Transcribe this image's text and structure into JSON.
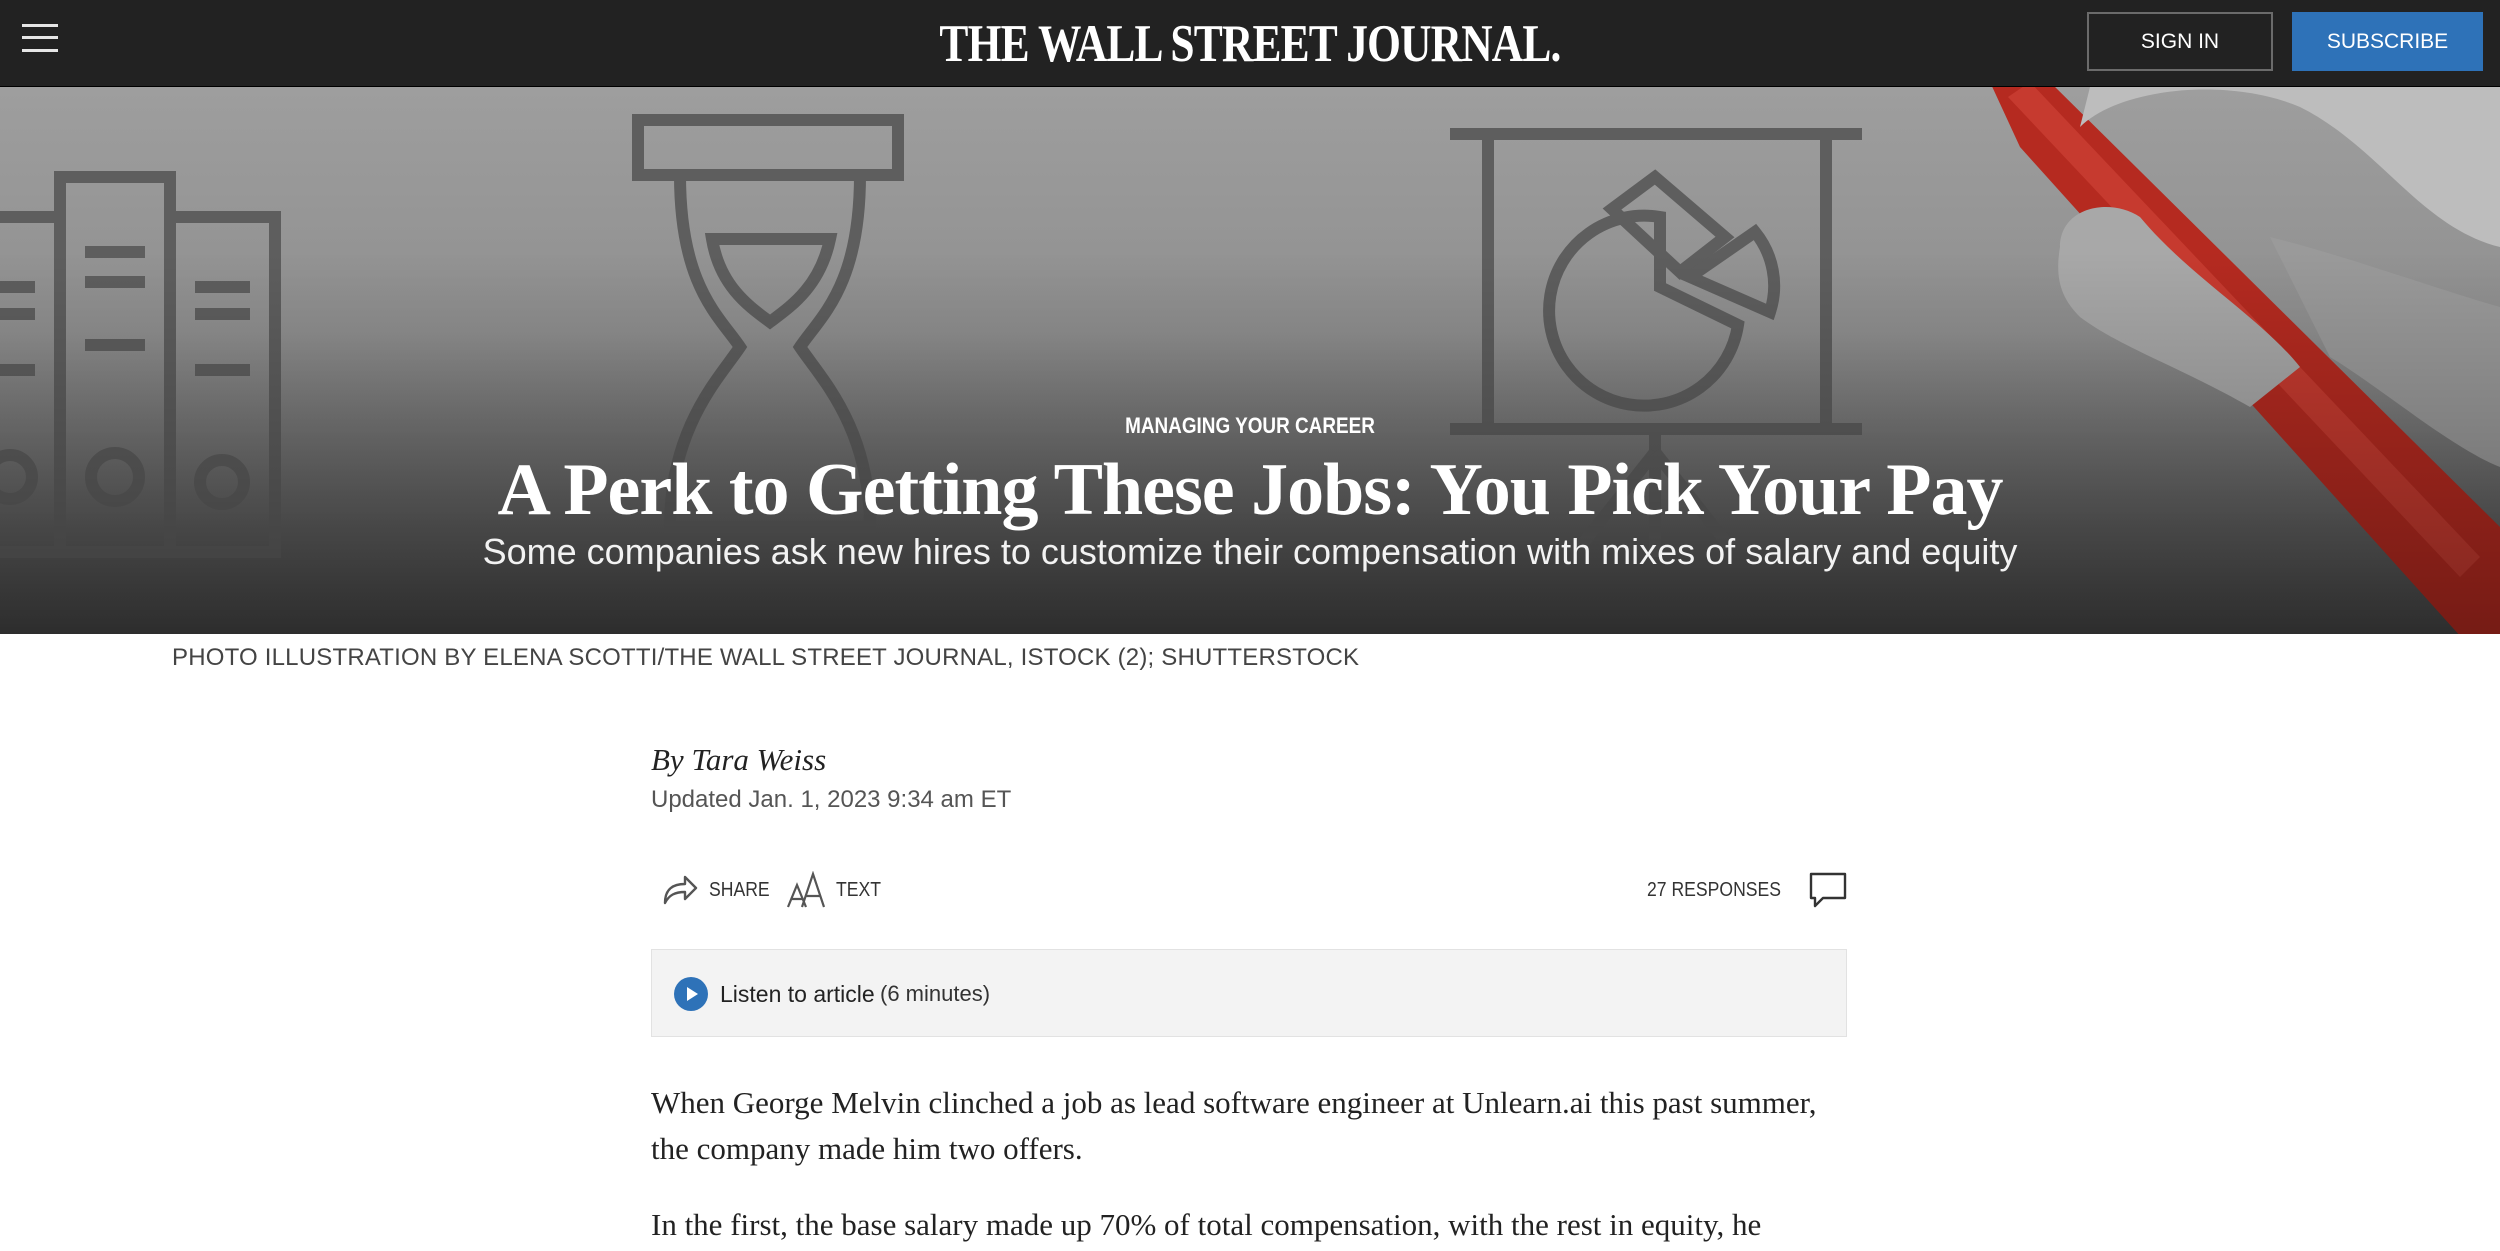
{
  "header": {
    "logo": "THE WALL STREET JOURNAL.",
    "sign_in": "SIGN IN",
    "subscribe": "SUBSCRIBE"
  },
  "hero": {
    "kicker": "MANAGING YOUR CAREER",
    "headline": "A Perk to Getting These Jobs: You Pick Your Pay",
    "dek": "Some companies ask new hires to customize their compensation with mixes of salary and equity"
  },
  "photo_credit": "PHOTO ILLUSTRATION BY ELENA SCOTTI/THE WALL STREET JOURNAL, ISTOCK (2); SHUTTERSTOCK",
  "article": {
    "byline": "By Tara Weiss",
    "updated": "Updated Jan. 1, 2023 9:34 am ET",
    "tools": {
      "share": "SHARE",
      "text": "TEXT",
      "responses": "27 RESPONSES"
    },
    "audio": {
      "label": "Listen to article",
      "duration": "(6 minutes)"
    },
    "paragraphs": [
      "When George Melvin clinched a job as lead software engineer at Unlearn.ai this past summer, the company made him two offers.",
      "In the first, the base salary made up 70% of total compensation, with the rest in equity, he"
    ]
  },
  "colors": {
    "topbar": "#222222",
    "accent_blue": "#2e72b8",
    "marker_red": "#b52a20"
  },
  "icons": {
    "menu": "hamburger-icon",
    "share": "share-arrow-icon",
    "text": "text-size-icon",
    "comments": "comment-bubble-icon",
    "audio": "play-icon"
  }
}
